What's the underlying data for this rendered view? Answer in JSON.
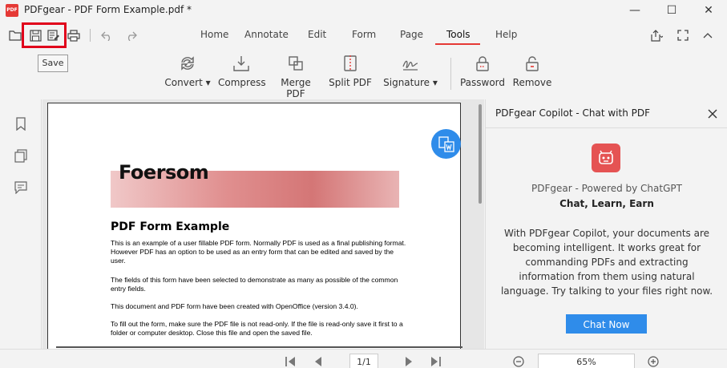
{
  "window": {
    "logo_text": "PDF",
    "title": "PDFgear - PDF Form Example.pdf *",
    "minimize": "—",
    "maximize": "☐",
    "close": "✕"
  },
  "quick_access": {
    "tooltip": "Save"
  },
  "tabs": [
    {
      "label": "Home"
    },
    {
      "label": "Annotate"
    },
    {
      "label": "Edit"
    },
    {
      "label": "Form"
    },
    {
      "label": "Page"
    },
    {
      "label": "Tools"
    },
    {
      "label": "Help"
    }
  ],
  "tools": [
    {
      "label": "Convert ▾"
    },
    {
      "label": "Compress"
    },
    {
      "label": "Merge PDF"
    },
    {
      "label": "Split PDF"
    },
    {
      "label": "Signature ▾"
    },
    {
      "label": "Password"
    },
    {
      "label": "Remove"
    }
  ],
  "document": {
    "banner": "Foersom",
    "title": "PDF Form Example",
    "paragraphs": [
      "This is an example of a user fillable PDF form. Normally PDF is used as a final publishing format. However PDF has an option to be used as an entry form that can be edited and saved by the user.",
      "The fields of this form have been selected to demonstrate as many as possible of the common entry fields.",
      "This document and PDF form have been created with OpenOffice (version 3.4.0).",
      "To fill out the form, make sure the PDF file is not read-only. If the file is read-only save it first to a folder or computer desktop. Close this file and open the saved file."
    ]
  },
  "copilot": {
    "header": "PDFgear Copilot - Chat with PDF",
    "powered": "PDFgear - Powered by ChatGPT",
    "slogan": "Chat, Learn, Earn",
    "description": "With PDFgear Copilot, your documents are becoming intelligent. It works great for commanding PDFs and extracting information from them using natural language. Try talking to your files right now.",
    "button": "Chat Now"
  },
  "navigation": {
    "page_indicator": "1/1",
    "zoom": "65%"
  },
  "colors": {
    "accent": "#e53935",
    "primary_blue": "#2f8cea",
    "highlight_box": "#e0001b"
  }
}
